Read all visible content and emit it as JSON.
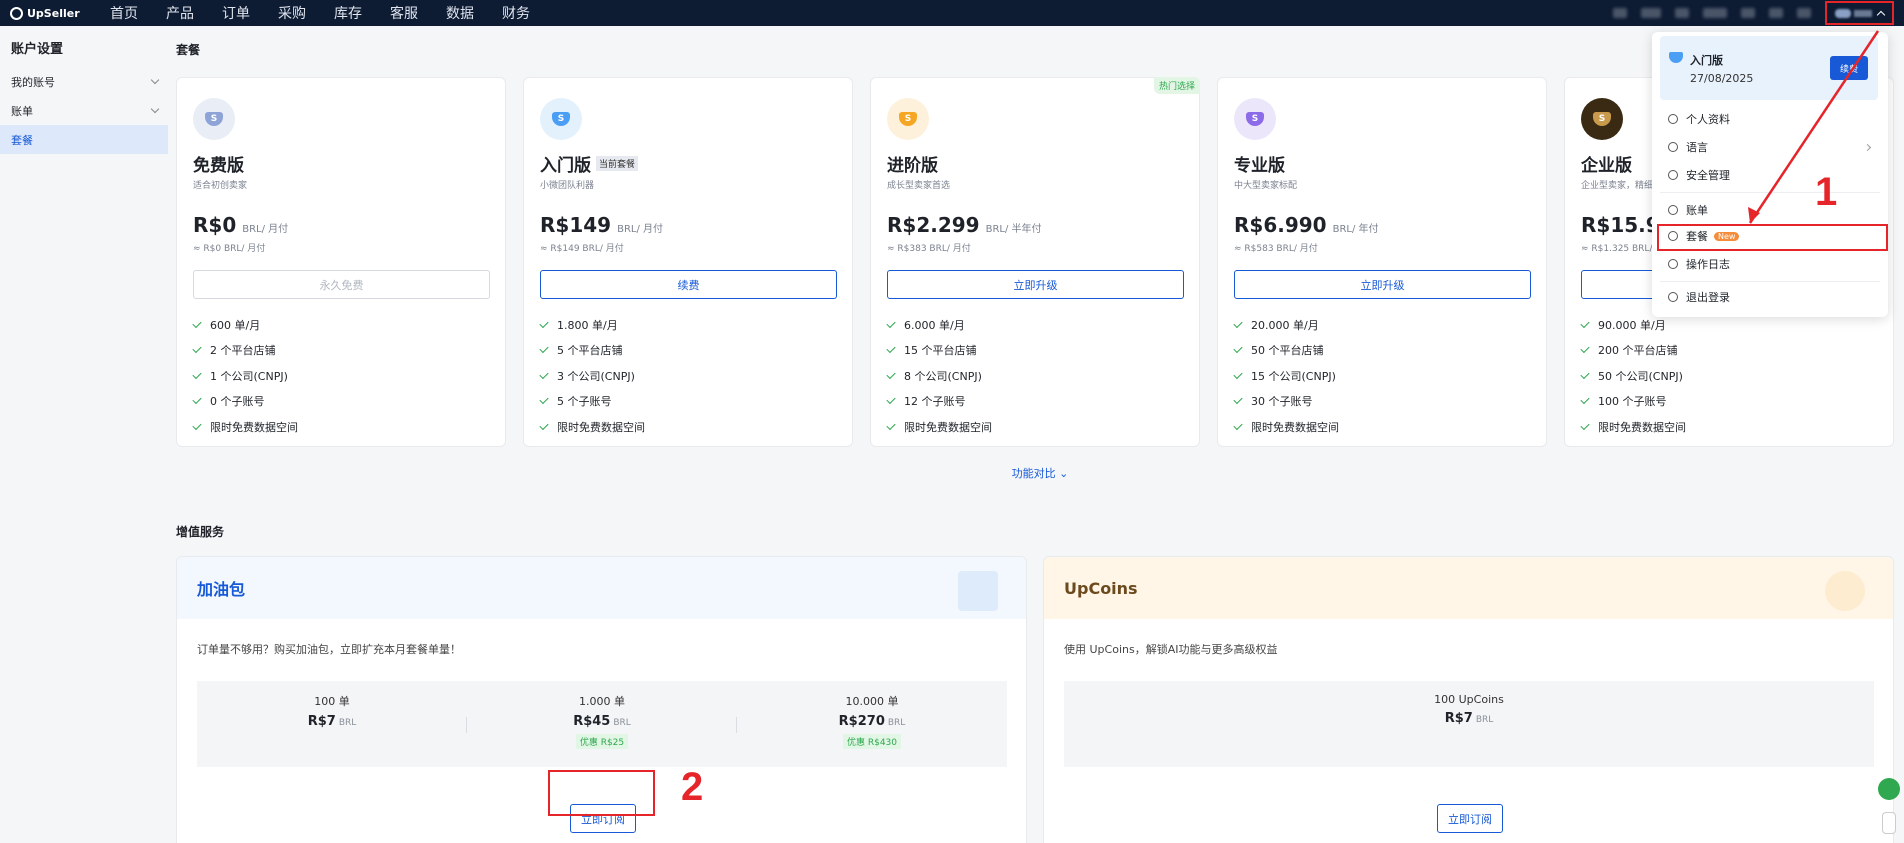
{
  "topbar": {
    "logo": "UpSeller",
    "nav": [
      "首页",
      "产品",
      "订单",
      "采购",
      "库存",
      "客服",
      "数据",
      "财务"
    ]
  },
  "sidebar": {
    "title": "账户设置",
    "items": [
      {
        "label": "我的账号",
        "expandable": true
      },
      {
        "label": "账单",
        "expandable": true
      },
      {
        "label": "套餐",
        "active": true
      }
    ]
  },
  "plans_section": {
    "title": "套餐",
    "plans": [
      {
        "name": "免费版",
        "subtitle": "适合初创卖家",
        "price": "R$0",
        "unit": "BRL/ 月付",
        "approx": "≈ R$0 BRL/ 月付",
        "button": "永久免费",
        "button_disabled": true,
        "icon_color": "#8fa4d6",
        "icon_bg": "#e9edf6",
        "features": [
          "600 单/月",
          "2 个平台店铺",
          "1 个公司(CNPJ)",
          "0 个子账号",
          "限时免费数据空间"
        ]
      },
      {
        "name": "入门版",
        "badge": "当前套餐",
        "subtitle": "小微团队利器",
        "price": "R$149",
        "unit": "BRL/ 月付",
        "approx": "≈ R$149 BRL/ 月付",
        "button": "续费",
        "icon_color": "#4a9ff5",
        "icon_bg": "#e3f1fd",
        "features": [
          "1.800 单/月",
          "5 个平台店铺",
          "3 个公司(CNPJ)",
          "5 个子账号",
          "限时免费数据空间"
        ]
      },
      {
        "name": "进阶版",
        "hot": "热门选择",
        "subtitle": "成长型卖家首选",
        "price": "R$2.299",
        "unit": "BRL/ 半年付",
        "approx": "≈ R$383 BRL/ 月付",
        "button": "立即升级",
        "icon_color": "#f5a623",
        "icon_bg": "#fdf1dc",
        "features": [
          "6.000 单/月",
          "15 个平台店铺",
          "8 个公司(CNPJ)",
          "12 个子账号",
          "限时免费数据空间"
        ]
      },
      {
        "name": "专业版",
        "subtitle": "中大型卖家标配",
        "price": "R$6.990",
        "unit": "BRL/ 年付",
        "approx": "≈ R$583 BRL/ 月付",
        "button": "立即升级",
        "icon_color": "#8c6be8",
        "icon_bg": "#ece6fb",
        "features": [
          "20.000 单/月",
          "50 个平台店铺",
          "15 个公司(CNPJ)",
          "30 个子账号",
          "限时免费数据空间"
        ]
      },
      {
        "name": "企业版",
        "subtitle": "企业型卖家，精细",
        "price": "R$15.90",
        "unit": "",
        "approx": "≈ R$1.325 BRL/ 月付",
        "button": "",
        "icon_color": "#6b4a1e",
        "icon_bg": "#3a2a14",
        "features": [
          "90.000 单/月",
          "200 个平台店铺",
          "50 个公司(CNPJ)",
          "100 个子账号",
          "限时免费数据空间"
        ]
      }
    ],
    "compare_link": "功能对比"
  },
  "vas_section": {
    "title": "增值服务",
    "fuel": {
      "title": "加油包",
      "desc": "订单量不够用？购买加油包，立即扩充本月套餐单量！",
      "options": [
        {
          "qty": "100 单",
          "price": "R$7",
          "currency": "BRL",
          "discount": ""
        },
        {
          "qty": "1.000 单",
          "price": "R$45",
          "currency": "BRL",
          "discount": "优惠 R$25"
        },
        {
          "qty": "10.000 单",
          "price": "R$270",
          "currency": "BRL",
          "discount": "优惠 R$430"
        }
      ],
      "button": "立即订阅"
    },
    "upcoins": {
      "title": "UpCoins",
      "desc": "使用 UpCoins，解锁AI功能与更多高级权益",
      "option": {
        "qty": "100 UpCoins",
        "price": "R$7",
        "currency": "BRL"
      },
      "button": "立即订阅"
    }
  },
  "dropdown": {
    "plan": "入门版",
    "date": "27/08/2025",
    "renew": "续费",
    "items": [
      {
        "label": "个人资料",
        "icon": "user-icon"
      },
      {
        "label": "语言",
        "icon": "globe-icon",
        "arrow": true
      },
      {
        "label": "安全管理",
        "icon": "shield-icon"
      },
      {
        "label": "账单",
        "icon": "bill-icon"
      },
      {
        "label": "套餐",
        "icon": "package-icon",
        "badge": "New"
      },
      {
        "label": "操作日志",
        "icon": "log-icon"
      },
      {
        "label": "退出登录",
        "icon": "logout-icon"
      }
    ]
  },
  "annotations": {
    "one": "1",
    "two": "2"
  }
}
